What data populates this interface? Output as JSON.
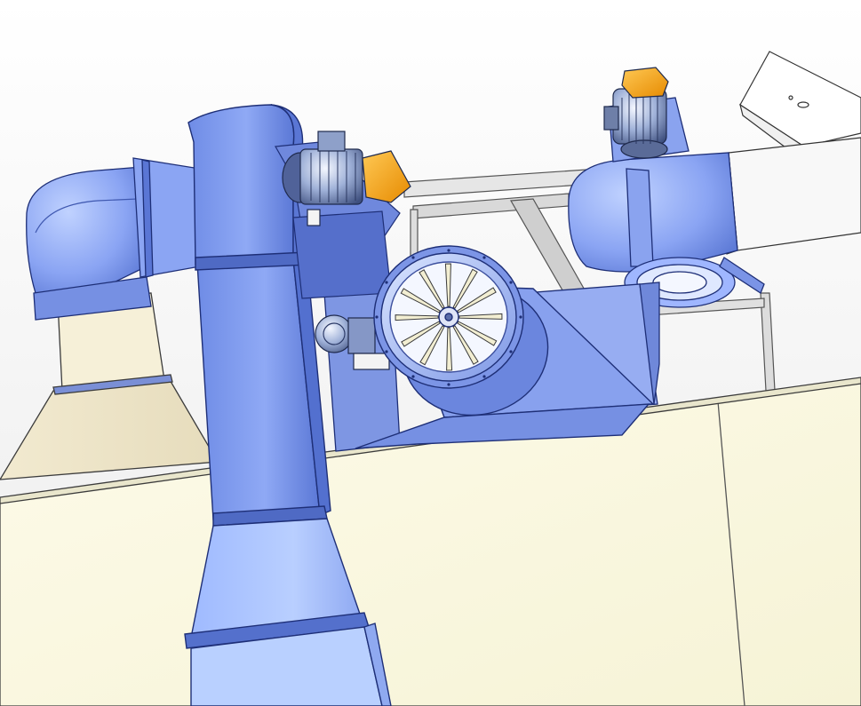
{
  "viewport": {
    "background_top": "#ffffff",
    "background_bottom": "#eeeeee"
  },
  "colors": {
    "duct_blue": "#7f9bed",
    "duct_light": "#a8c1ff",
    "duct_dark": "#4f6ac4",
    "duct_edge": "#1e2f77",
    "housing_cream": "#fdfbe6",
    "housing_edge": "#3c3c3c",
    "motor_orange": "#f7a21b",
    "frame_grey": "#dcdcdc",
    "blade_cream": "#f2eed2"
  },
  "objects": [
    {
      "name": "centrifugal-fan-left"
    },
    {
      "name": "centrifugal-fan-right"
    },
    {
      "name": "axial-fan-center"
    },
    {
      "name": "vertical-duct"
    },
    {
      "name": "electric-motor-left"
    },
    {
      "name": "electric-motor-right"
    },
    {
      "name": "small-motor-center"
    },
    {
      "name": "support-frame"
    },
    {
      "name": "hood-cone"
    },
    {
      "name": "housing-wall"
    },
    {
      "name": "duct-roof-right"
    },
    {
      "name": "control-box-top-right"
    }
  ],
  "axial_fan": {
    "blade_count": 12
  }
}
